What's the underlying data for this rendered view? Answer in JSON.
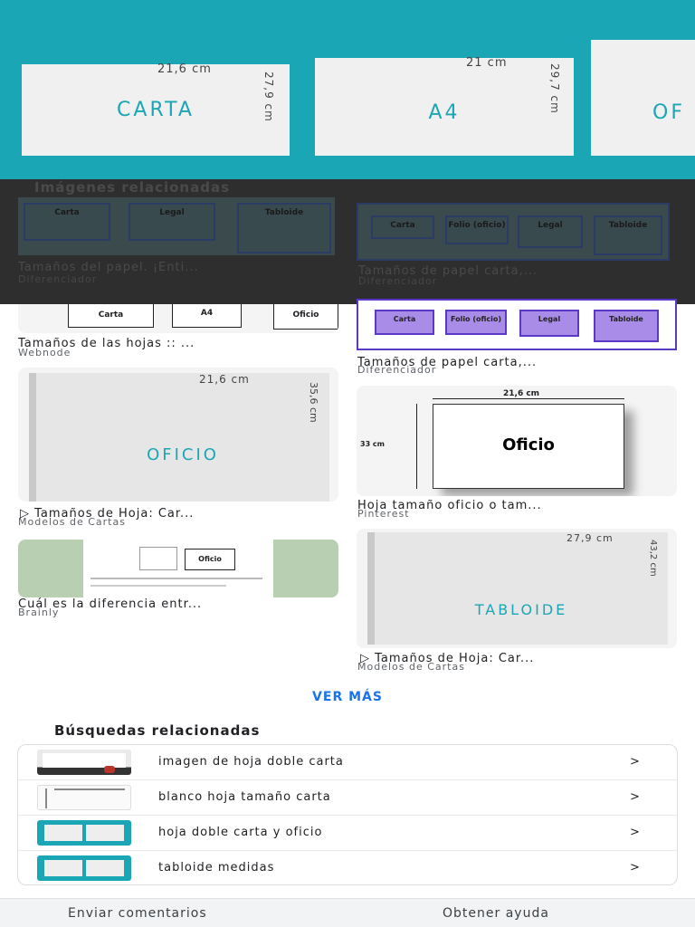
{
  "hero": {
    "sheets": [
      {
        "name": "CARTA",
        "width": "21,6 cm",
        "height": "27,9 cm"
      },
      {
        "name": "A4",
        "width": "21 cm",
        "height": "29,7 cm"
      },
      {
        "name": "OF"
      }
    ]
  },
  "related_images": {
    "title": "Imágenes relacionadas",
    "items": [
      {
        "caption": "Tamaños del papel. ¡Enti...",
        "source": "Diferenciador",
        "boxes": [
          "Carta",
          "Legal",
          "Tabloide"
        ]
      },
      {
        "caption": "Tamaños de papel carta,...",
        "source": "Diferenciador",
        "boxes": [
          "Carta",
          "Folio (oficio)",
          "Legal",
          "Tabloide"
        ]
      }
    ]
  },
  "results": [
    {
      "caption": "Tamaños de las hojas :: ...",
      "source": "Webnode",
      "boxes": [
        "Carta",
        "A4",
        "Oficio"
      ]
    },
    {
      "caption": "Tamaños de papel carta,...",
      "source": "Diferenciador",
      "boxes": [
        "Carta",
        "Folio (oficio)",
        "Legal",
        "Tabloide"
      ]
    },
    {
      "caption": "Tamaños de Hoja: Car...",
      "source": "Modelos de Cartas",
      "sheet_name": "OFICIO",
      "width": "21,6 cm",
      "height": "35,6 cm"
    },
    {
      "caption": "Hoja tamaño oficio o tam...",
      "source": "Pinterest",
      "sheet_name": "Oficio",
      "width": "21,6 cm",
      "height": "33 cm"
    },
    {
      "caption": "Cuál es la diferencia entr...",
      "source": "Brainly",
      "sheet_name": "Oficio"
    },
    {
      "caption": "Tamaños de Hoja: Car...",
      "source": "Modelos de Cartas",
      "sheet_name": "TABLOIDE",
      "width": "27,9 cm",
      "height": "43,2 cm"
    }
  ],
  "ver_mas": "VER MÁS",
  "related_searches": {
    "title": "Búsquedas relacionadas",
    "items": [
      {
        "label": "imagen de hoja doble carta",
        "chevron": ">"
      },
      {
        "label": "blanco hoja tamaño carta",
        "chevron": ">"
      },
      {
        "label": "hoja doble carta y oficio",
        "chevron": ">"
      },
      {
        "label": "tabloide medidas",
        "chevron": ">"
      }
    ]
  },
  "footer": {
    "feedback": "Enviar comentarios",
    "help": "Obtener ayuda"
  },
  "colors": {
    "teal": "#1aa6b5",
    "link": "#1a73e8",
    "purple": "#a98be8"
  }
}
